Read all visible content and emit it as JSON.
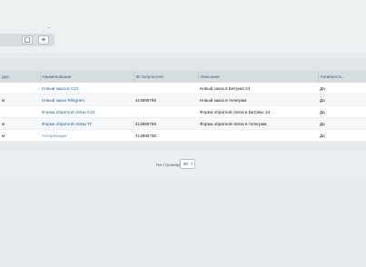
{
  "toolbar": {
    "dash": "–",
    "button_small": "▢",
    "button_add": "+"
  },
  "table": {
    "headers": [
      "дер",
      "Наименование",
      "ID получателя",
      "Описание",
      "Активность"
    ],
    "rows": [
      [
        "",
        "Новый заказ в С24",
        "",
        "Новый заказ в Битрикс 24",
        "Да"
      ],
      [
        "м",
        "Новый заказ Telegram",
        "413896765",
        "Новый заказ в телеграм",
        "Да"
      ],
      [
        "",
        "Форма обратной связи С24",
        "",
        "Форма обратной связи в Битрикс 24",
        "Да"
      ],
      [
        "м",
        "Форма обратной связи ТГ",
        "413896765",
        "Форма обратной связи в телеграм",
        "Да"
      ],
      [
        "м",
        "Авторизация",
        "413896765",
        "",
        "Да"
      ]
    ]
  },
  "pagination": {
    "per_page_label": "На странице:",
    "per_page_value": "20"
  }
}
